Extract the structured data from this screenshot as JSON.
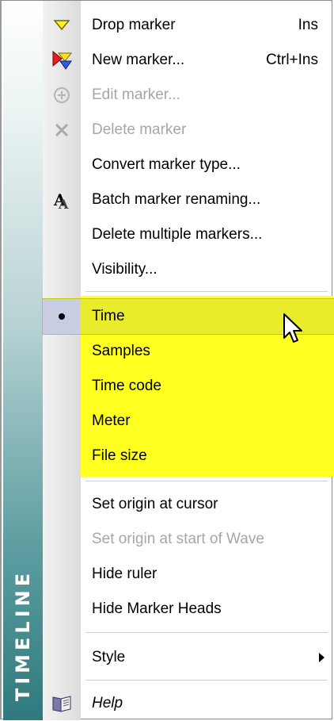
{
  "sidebar": {
    "title": "TIMELINE"
  },
  "menu": {
    "items": [
      {
        "label": "Drop marker",
        "shortcut": "Ins",
        "icon": "drop-marker-icon"
      },
      {
        "label": "New marker...",
        "shortcut": "Ctrl+Ins",
        "icon": "new-marker-icon"
      },
      {
        "label": "Edit marker...",
        "icon": "edit-marker-icon",
        "disabled": true
      },
      {
        "label": "Delete marker",
        "icon": "delete-marker-icon",
        "disabled": true
      },
      {
        "label": "Convert marker type..."
      },
      {
        "label": "Batch marker renaming...",
        "icon": "batch-rename-icon"
      },
      {
        "label": "Delete multiple markers..."
      },
      {
        "label": "Visibility..."
      },
      {
        "label": "Time",
        "selected": true
      },
      {
        "label": "Samples"
      },
      {
        "label": "Time code"
      },
      {
        "label": "Meter"
      },
      {
        "label": "File size"
      },
      {
        "label": "Set origin at cursor"
      },
      {
        "label": "Set origin at start of Wave",
        "disabled": true
      },
      {
        "label": "Hide ruler"
      },
      {
        "label": "Hide Marker Heads"
      },
      {
        "label": "Style"
      },
      {
        "label": "Help",
        "icon": "help-book-icon"
      }
    ]
  },
  "colors": {
    "highlight": "#ffff20",
    "selected": "#e8ec2a",
    "sidebar_bottom": "#2e7a7e",
    "disabled_text": "#a6a6a6"
  }
}
